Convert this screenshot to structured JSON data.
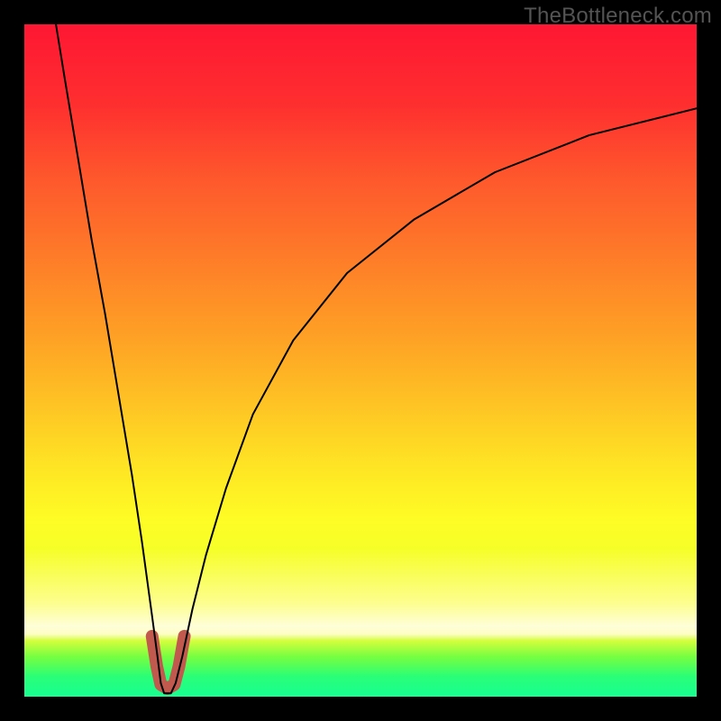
{
  "watermark": "TheBottleneck.com",
  "chart_data": {
    "type": "line",
    "title": "",
    "xlabel": "",
    "ylabel": "",
    "xlim": [
      0,
      100
    ],
    "ylim": [
      0,
      100
    ],
    "background_gradient": {
      "stops": [
        {
          "offset": 0.0,
          "color": "#fe1733"
        },
        {
          "offset": 0.12,
          "color": "#fe2f2f"
        },
        {
          "offset": 0.23,
          "color": "#fe582c"
        },
        {
          "offset": 0.34,
          "color": "#fe7a29"
        },
        {
          "offset": 0.46,
          "color": "#fe9f25"
        },
        {
          "offset": 0.57,
          "color": "#fec524"
        },
        {
          "offset": 0.66,
          "color": "#fee524"
        },
        {
          "offset": 0.74,
          "color": "#fefd25"
        },
        {
          "offset": 0.78,
          "color": "#f6fe28"
        },
        {
          "offset": 0.86,
          "color": "#fdfe8d"
        },
        {
          "offset": 0.895,
          "color": "#fefed8"
        },
        {
          "offset": 0.907,
          "color": "#fdfec4"
        },
        {
          "offset": 0.917,
          "color": "#d4fe3c"
        },
        {
          "offset": 0.94,
          "color": "#79fe40"
        },
        {
          "offset": 0.97,
          "color": "#2afe77"
        },
        {
          "offset": 1.0,
          "color": "#17fe91"
        }
      ]
    },
    "series": [
      {
        "name": "bottleneck-curve",
        "stroke": "#000000",
        "stroke_width": 2,
        "points": [
          {
            "x": 4.7,
            "y": 100.0
          },
          {
            "x": 6.0,
            "y": 92.0
          },
          {
            "x": 8.0,
            "y": 80.0
          },
          {
            "x": 10.0,
            "y": 68.0
          },
          {
            "x": 12.0,
            "y": 57.0
          },
          {
            "x": 14.0,
            "y": 45.0
          },
          {
            "x": 16.0,
            "y": 33.0
          },
          {
            "x": 17.5,
            "y": 23.0
          },
          {
            "x": 19.0,
            "y": 12.0
          },
          {
            "x": 19.8,
            "y": 6.0
          },
          {
            "x": 20.3,
            "y": 2.0
          },
          {
            "x": 20.8,
            "y": 0.5
          },
          {
            "x": 21.8,
            "y": 0.5
          },
          {
            "x": 22.5,
            "y": 2.0
          },
          {
            "x": 23.5,
            "y": 6.0
          },
          {
            "x": 25.0,
            "y": 13.0
          },
          {
            "x": 27.0,
            "y": 21.0
          },
          {
            "x": 30.0,
            "y": 31.0
          },
          {
            "x": 34.0,
            "y": 42.0
          },
          {
            "x": 40.0,
            "y": 53.0
          },
          {
            "x": 48.0,
            "y": 63.0
          },
          {
            "x": 58.0,
            "y": 71.0
          },
          {
            "x": 70.0,
            "y": 78.0
          },
          {
            "x": 84.0,
            "y": 83.5
          },
          {
            "x": 100.0,
            "y": 87.5
          }
        ]
      },
      {
        "name": "highlight-segment",
        "stroke": "#c1594e",
        "stroke_width": 14,
        "stroke_linecap": "round",
        "points": [
          {
            "x": 19.0,
            "y": 9.0
          },
          {
            "x": 19.7,
            "y": 4.5
          },
          {
            "x": 20.3,
            "y": 1.8
          },
          {
            "x": 21.3,
            "y": 1.2
          },
          {
            "x": 22.3,
            "y": 1.8
          },
          {
            "x": 23.0,
            "y": 4.5
          },
          {
            "x": 23.8,
            "y": 9.0
          }
        ]
      }
    ]
  }
}
